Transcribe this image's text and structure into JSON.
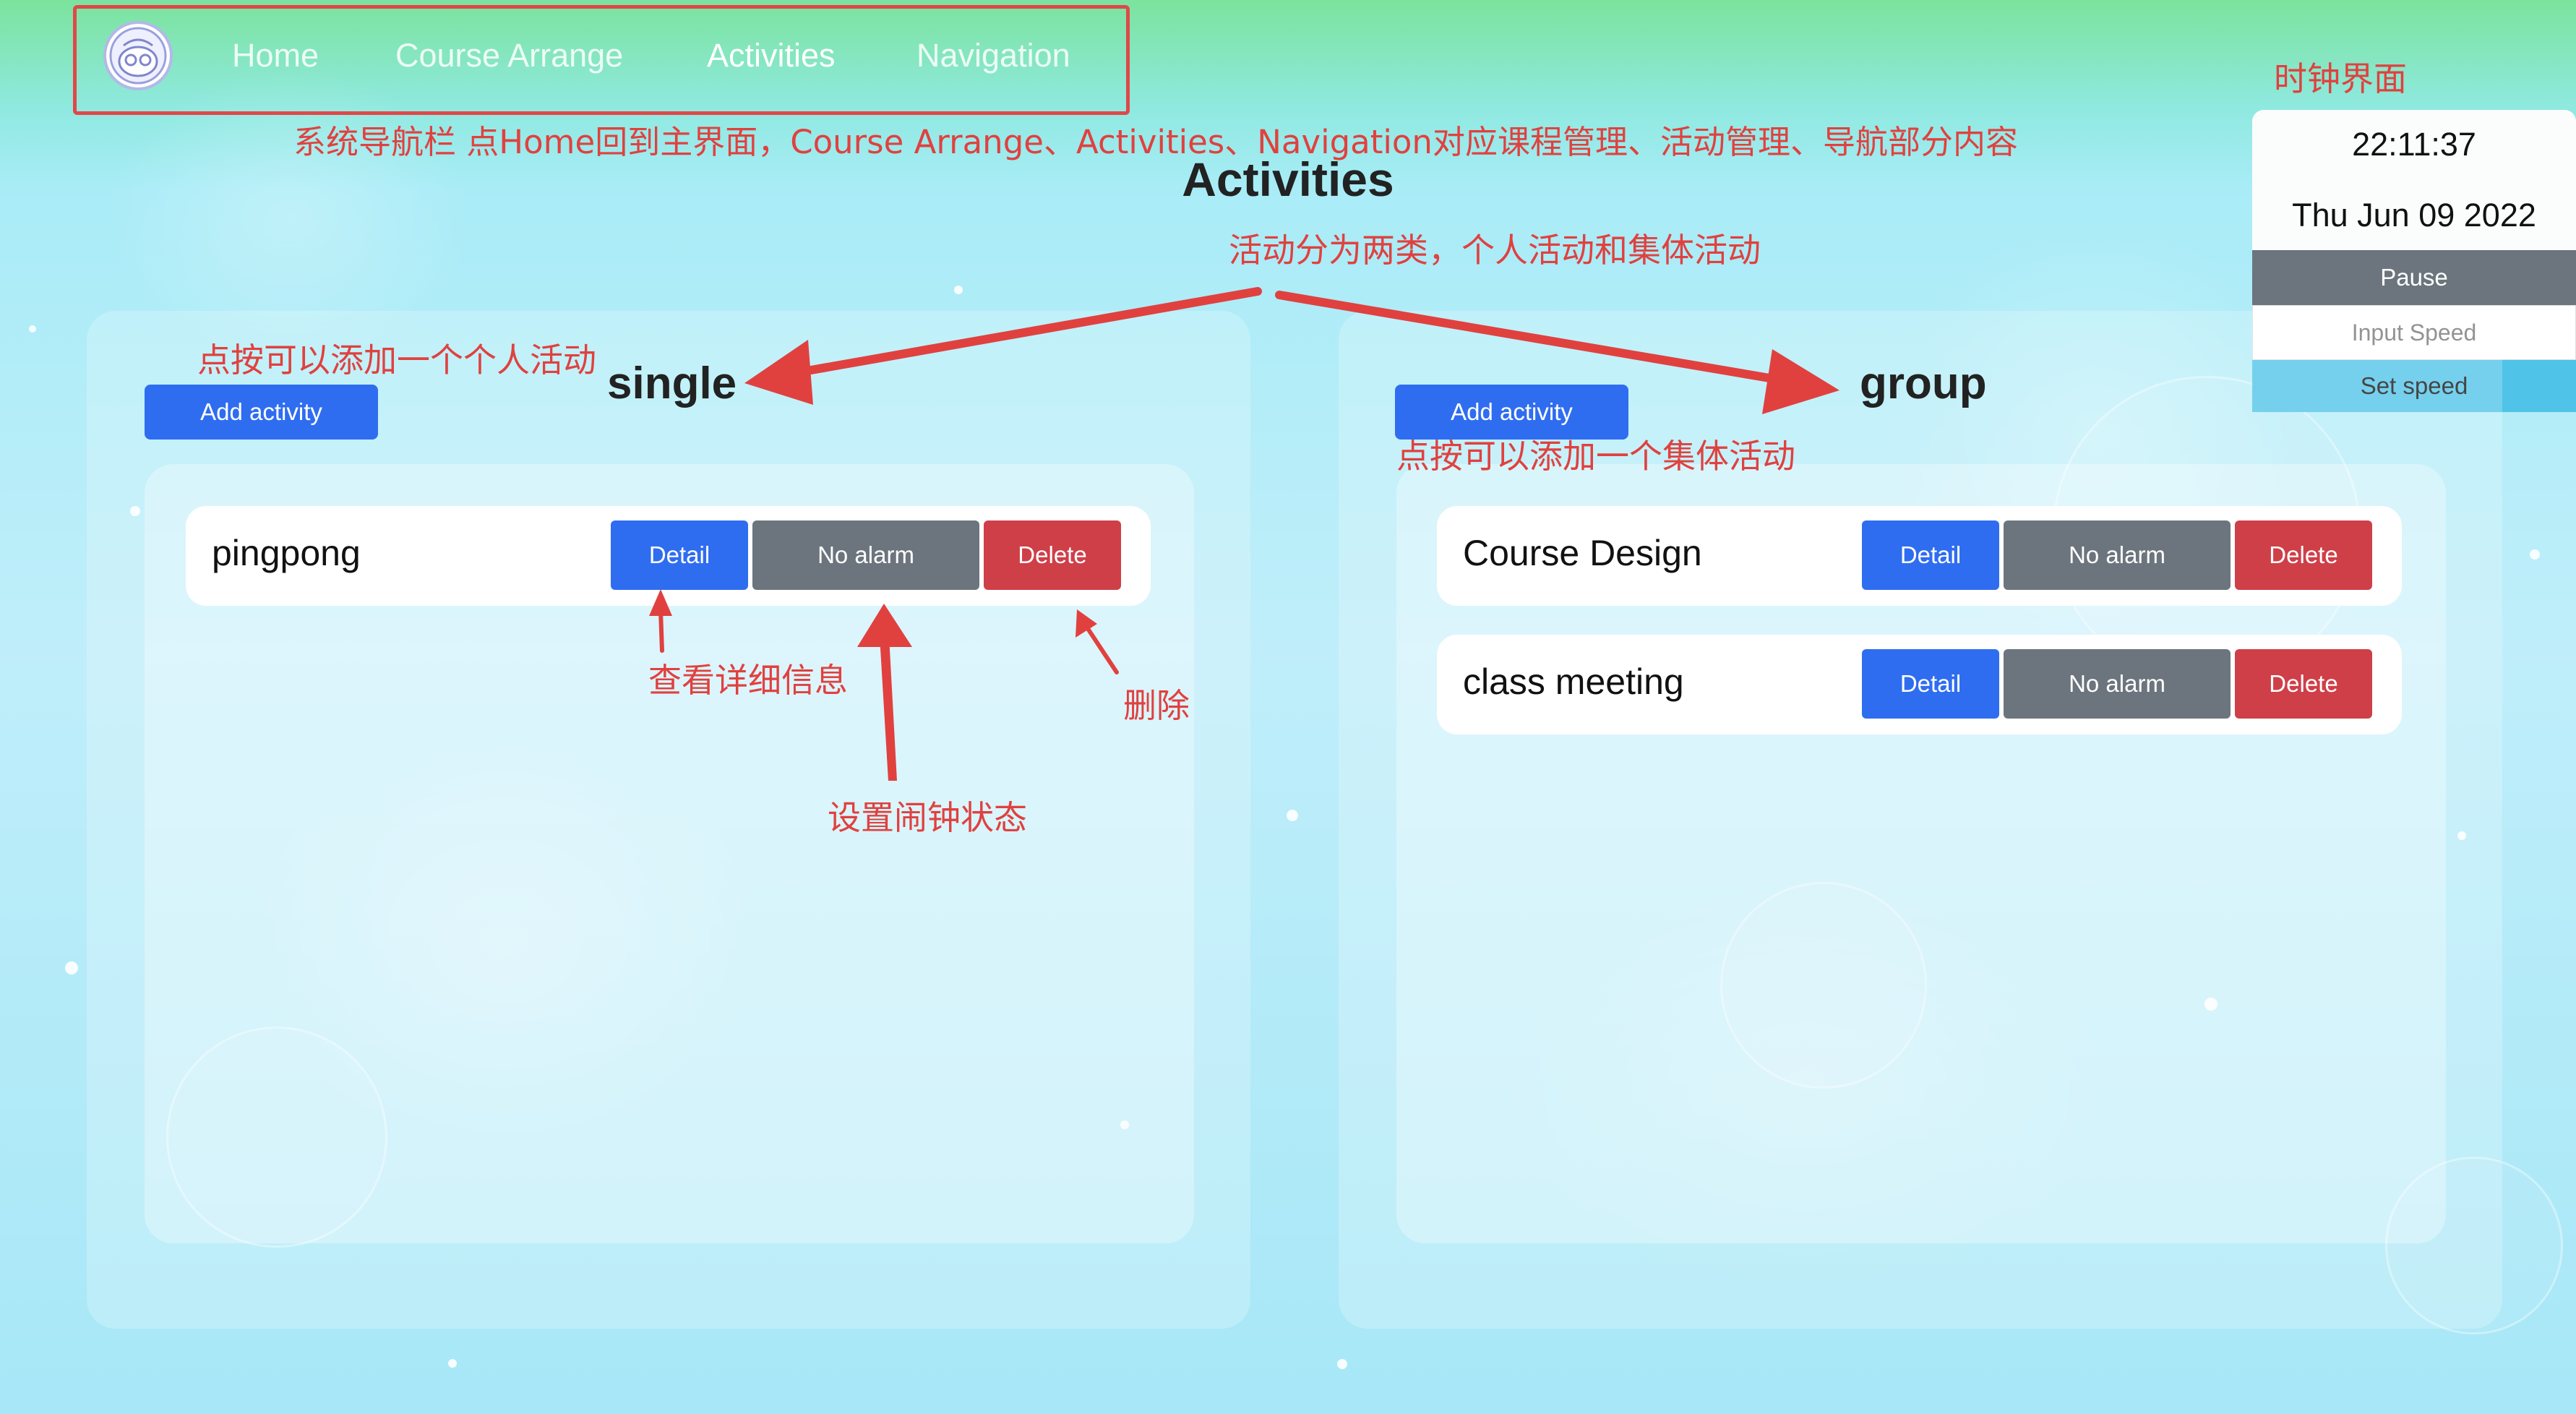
{
  "nav": {
    "links": [
      "Home",
      "Course Arrange",
      "Activities",
      "Navigation"
    ],
    "active": "Activities"
  },
  "page": {
    "title": "Activities"
  },
  "clock": {
    "time": "22:11:37",
    "date": "Thu Jun 09 2022",
    "pause_label": "Pause",
    "speed_placeholder": "Input Speed",
    "set_label": "Set speed"
  },
  "single": {
    "title": "single",
    "add_label": "Add activity",
    "items": [
      {
        "name": "pingpong",
        "detail": "Detail",
        "alarm": "No alarm",
        "delete": "Delete"
      }
    ]
  },
  "group": {
    "title": "group",
    "add_label": "Add activity",
    "items": [
      {
        "name": "Course Design",
        "detail": "Detail",
        "alarm": "No alarm",
        "delete": "Delete"
      },
      {
        "name": "class meeting",
        "detail": "Detail",
        "alarm": "No alarm",
        "delete": "Delete"
      }
    ]
  },
  "annotations": {
    "nav_note": "系统导航栏 点Home回到主界面，Course Arrange、Activities、Navigation对应课程管理、活动管理、导航部分内容",
    "clock_note": "时钟界面",
    "types_note": "活动分为两类，个人活动和集体活动",
    "add_single_note": "点按可以添加一个个人活动",
    "add_group_note": "点按可以添加一个集体活动",
    "detail_note": "查看详细信息",
    "delete_note": "删除",
    "alarm_note": "设置闹钟状态"
  },
  "colors": {
    "primary": "#2f6df0",
    "secondary": "#6c757d",
    "danger": "#cf3f48",
    "info": "#4fc3e8",
    "annotation": "#e0413f"
  }
}
